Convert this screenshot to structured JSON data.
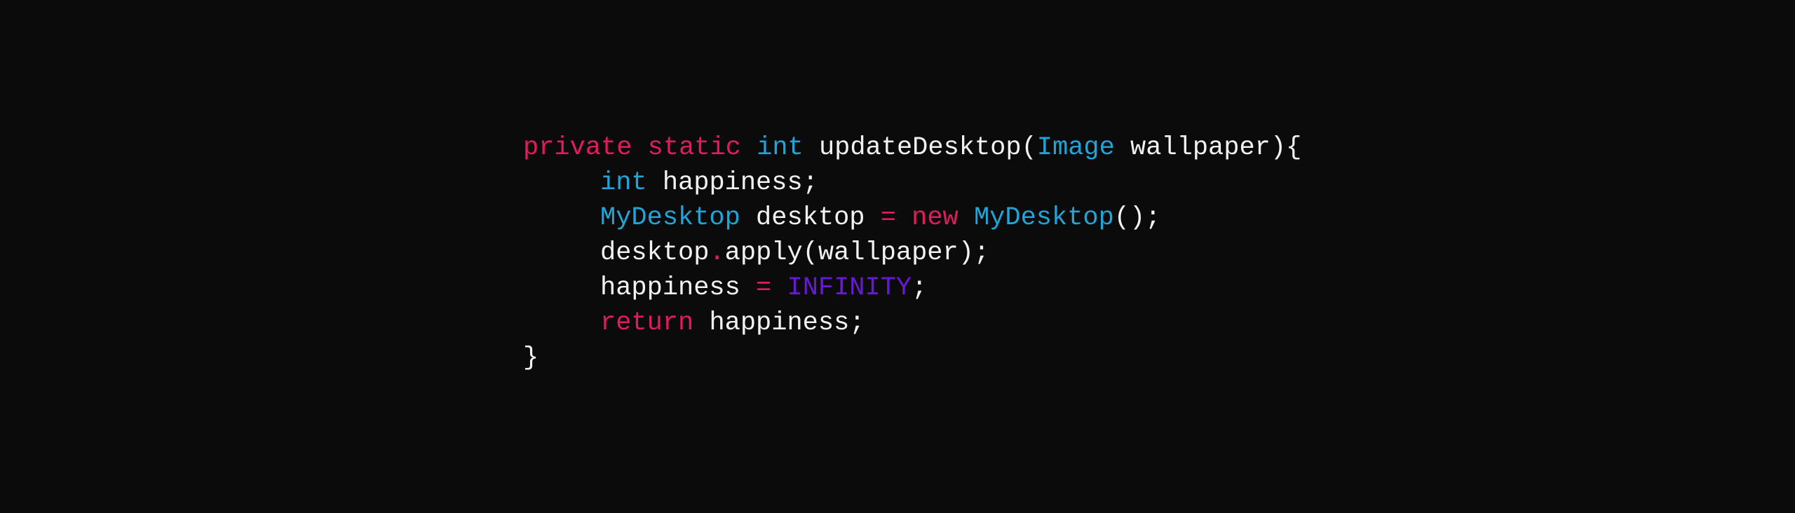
{
  "colors": {
    "background": "#0b0b0c",
    "keyword": "#e01d5c",
    "type": "#21a4d8",
    "constant": "#6a18d8",
    "plain": "#f2f2f2"
  },
  "code_lines": [
    {
      "indent": false,
      "tokens": [
        {
          "text": "private",
          "kind": "keyword"
        },
        {
          "text": " ",
          "kind": "plain"
        },
        {
          "text": "static",
          "kind": "keyword"
        },
        {
          "text": " ",
          "kind": "plain"
        },
        {
          "text": "int",
          "kind": "type"
        },
        {
          "text": " updateDesktop(",
          "kind": "plain"
        },
        {
          "text": "Image",
          "kind": "type"
        },
        {
          "text": " wallpaper){",
          "kind": "plain"
        }
      ]
    },
    {
      "indent": true,
      "tokens": [
        {
          "text": "int",
          "kind": "type"
        },
        {
          "text": " happiness;",
          "kind": "plain"
        }
      ]
    },
    {
      "indent": true,
      "tokens": [
        {
          "text": "MyDesktop",
          "kind": "type"
        },
        {
          "text": " desktop ",
          "kind": "plain"
        },
        {
          "text": "=",
          "kind": "operator"
        },
        {
          "text": " ",
          "kind": "plain"
        },
        {
          "text": "new",
          "kind": "keyword"
        },
        {
          "text": " ",
          "kind": "plain"
        },
        {
          "text": "MyDesktop",
          "kind": "type"
        },
        {
          "text": "();",
          "kind": "plain"
        }
      ]
    },
    {
      "indent": true,
      "tokens": [
        {
          "text": "desktop",
          "kind": "plain"
        },
        {
          "text": ".",
          "kind": "operator"
        },
        {
          "text": "apply(wallpaper);",
          "kind": "plain"
        }
      ]
    },
    {
      "indent": true,
      "tokens": [
        {
          "text": "happiness ",
          "kind": "plain"
        },
        {
          "text": "=",
          "kind": "operator"
        },
        {
          "text": " ",
          "kind": "plain"
        },
        {
          "text": "INFINITY",
          "kind": "constant"
        },
        {
          "text": ";",
          "kind": "plain"
        }
      ]
    },
    {
      "indent": true,
      "tokens": [
        {
          "text": "return",
          "kind": "keyword"
        },
        {
          "text": " happiness;",
          "kind": "plain"
        }
      ]
    },
    {
      "indent": false,
      "tokens": [
        {
          "text": "}",
          "kind": "plain"
        }
      ]
    }
  ]
}
